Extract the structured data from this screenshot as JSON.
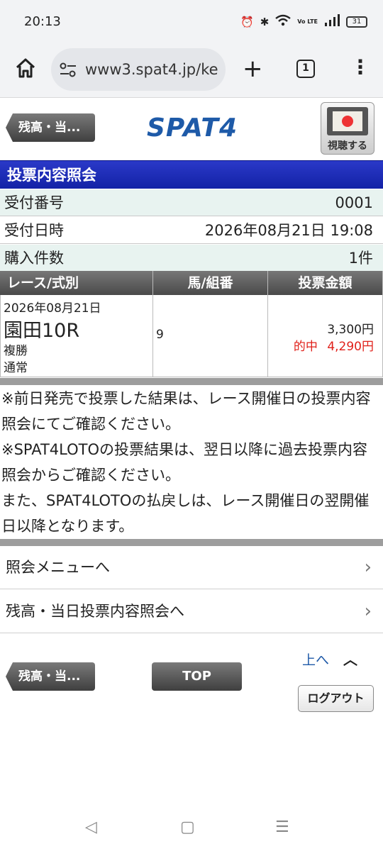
{
  "status": {
    "time": "20:13",
    "volte": "Vo LTE",
    "battery": "31"
  },
  "browser": {
    "url": "www3.spat4.jp/ke",
    "tab_count": "1",
    "new_tab": "+",
    "menu": "⋮"
  },
  "header": {
    "back_label": "残高・当...",
    "logo": "SPAT4",
    "watch_label": "視聴する"
  },
  "page": {
    "title": "投票内容照会",
    "info": [
      {
        "key": "受付番号",
        "value": "0001"
      },
      {
        "key": "受付日時",
        "value": "2026年08月21日 19:08"
      },
      {
        "key": "購入件数",
        "value": "1件"
      }
    ]
  },
  "table": {
    "headers": [
      "レース/式別",
      "馬/組番",
      "投票金額"
    ],
    "row": {
      "date": "2026年08月21日",
      "race": "園田10R",
      "bet_type": "複勝",
      "method": "通常",
      "horse": "9",
      "amount": "3,300円",
      "hit_label": "的中",
      "payout": "4,290円"
    }
  },
  "notes": [
    "※前日発売で投票した結果は、レース開催日の投票内容照会にてご確認ください。",
    "※SPAT4LOTOの投票結果は、翌日以降に過去投票内容照会からご確認ください。",
    "また、SPAT4LOTOの払戻しは、レース開催日の翌開催日以降となります。"
  ],
  "menu": [
    {
      "label": "照会メニューへ"
    },
    {
      "label": "残高・当日投票内容照会へ"
    }
  ],
  "footer": {
    "back_label": "残高・当...",
    "top_label": "TOP",
    "up_label": "上へ",
    "logout_label": "ログアウト"
  },
  "colors": {
    "title_bar": "#1a2bb8",
    "row_shade": "#e8f3f0",
    "hit_red": "#e0201a",
    "link_blue": "#1f5aa8"
  }
}
